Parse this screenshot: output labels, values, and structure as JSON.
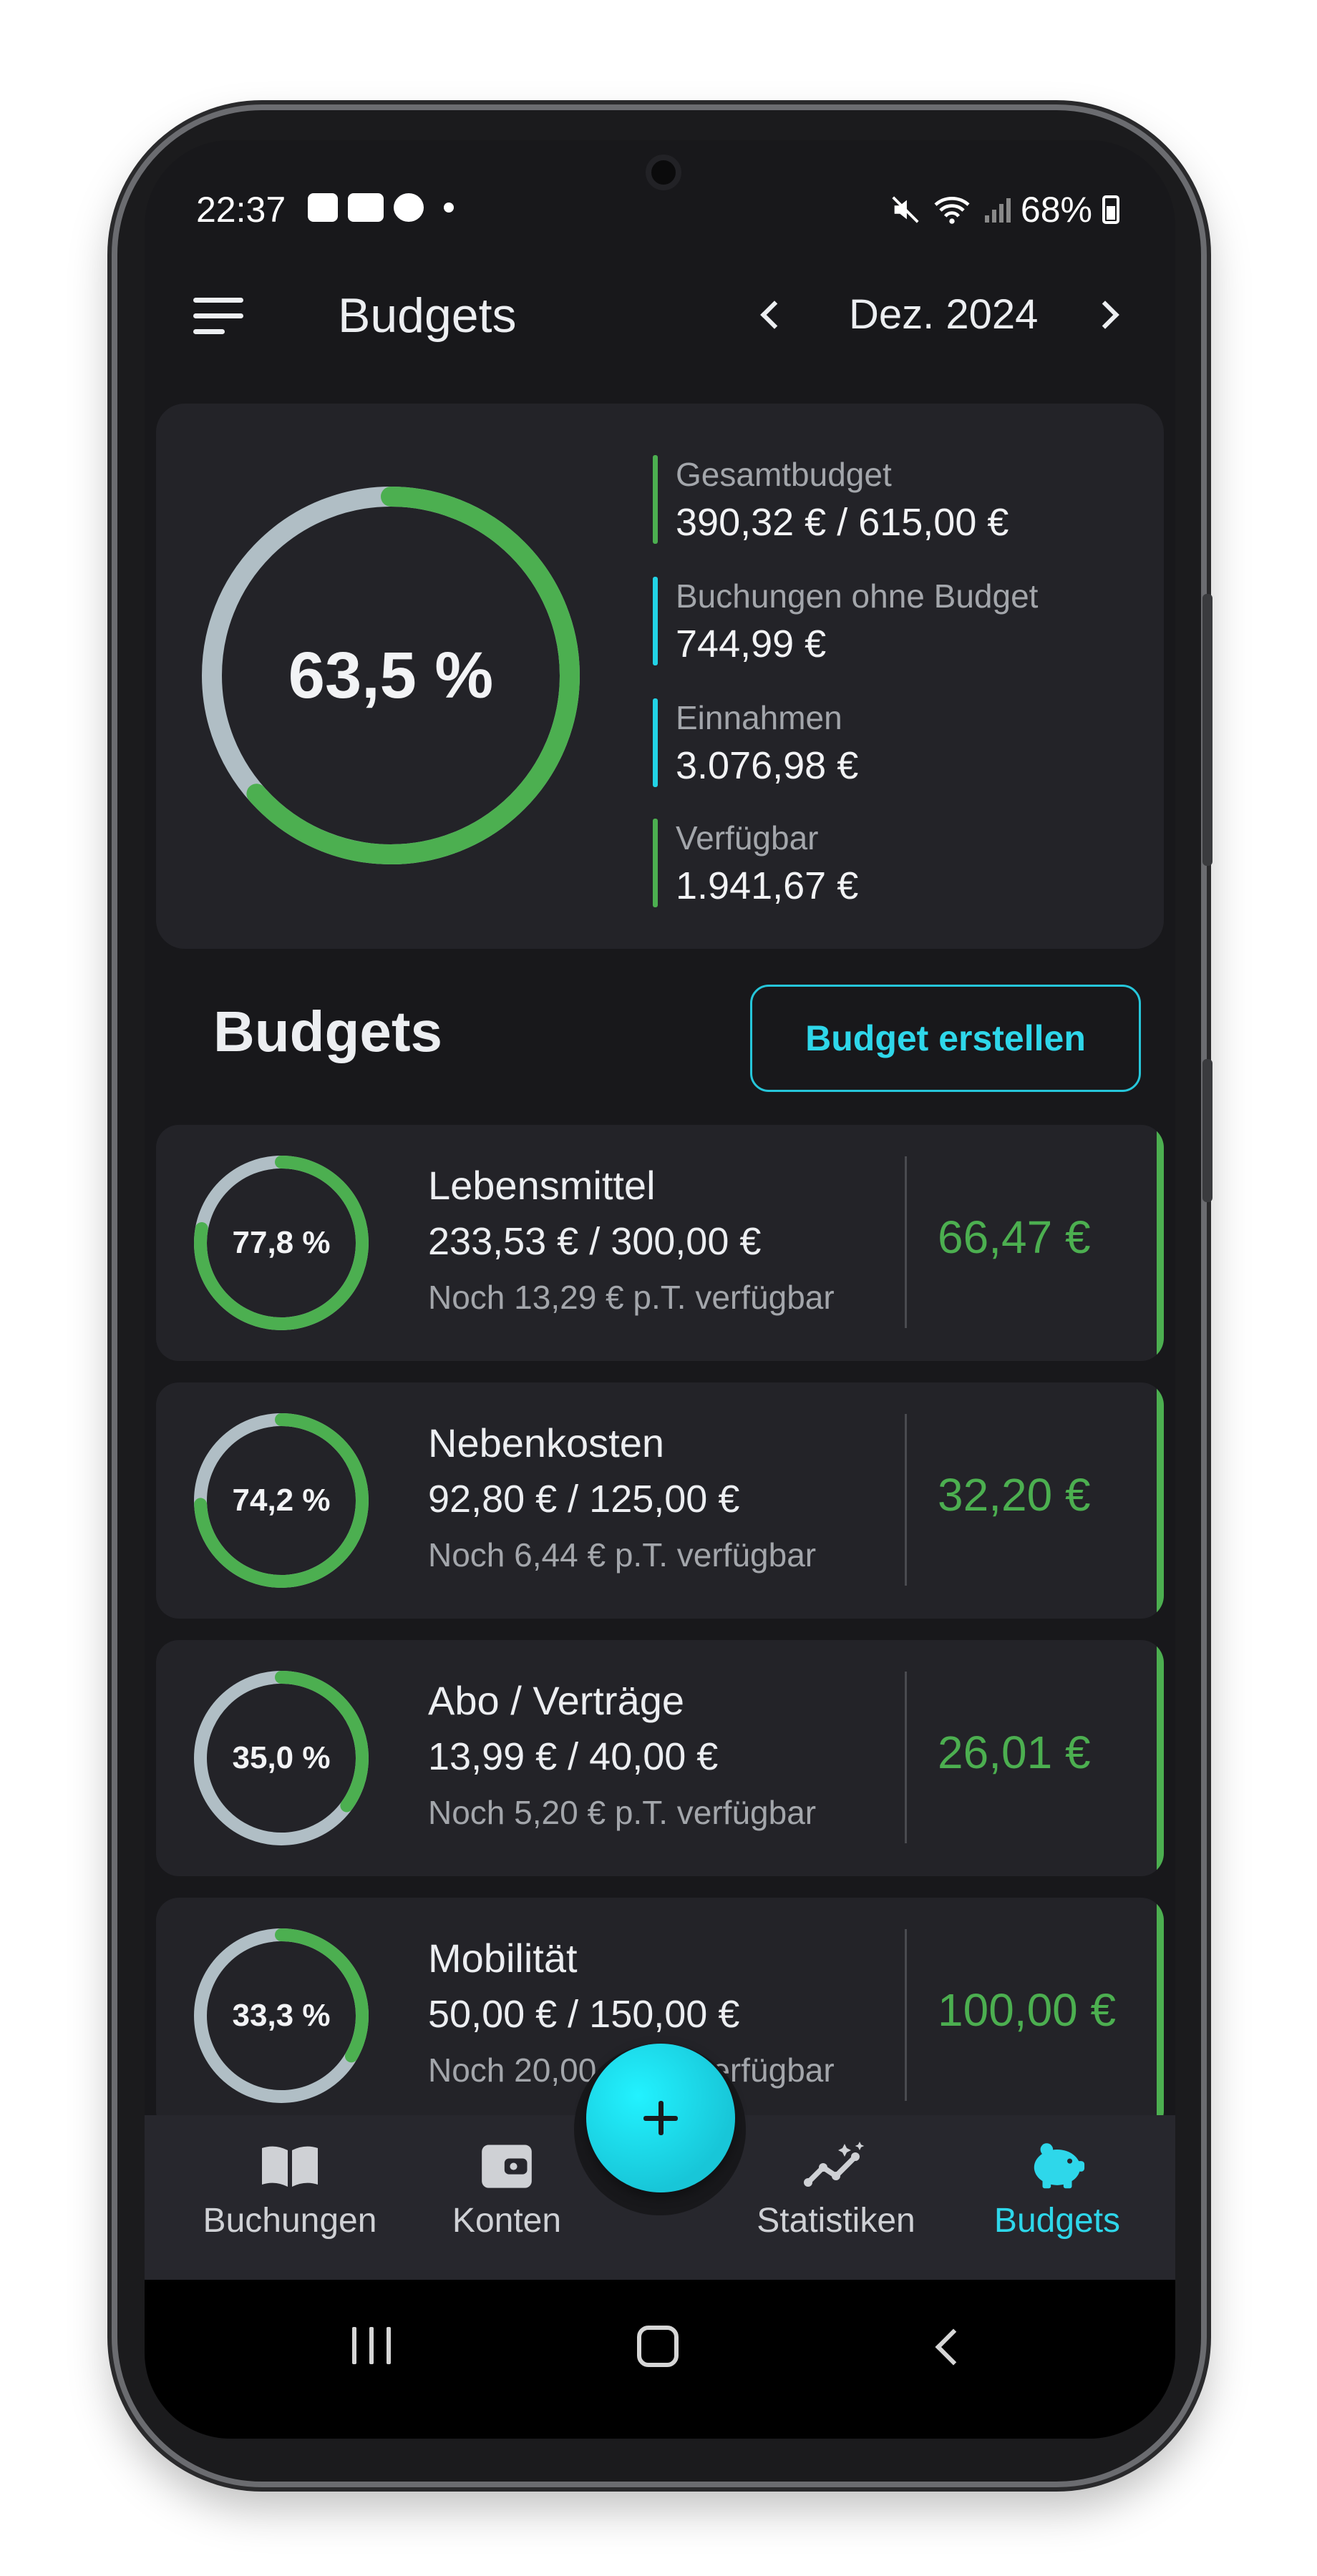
{
  "status_bar": {
    "time": "22:37",
    "battery": "68%"
  },
  "app_bar": {
    "title": "Budgets",
    "month": "Dez. 2024"
  },
  "summary": {
    "percent_label": "63,5 %",
    "percent_used": 63.5,
    "stats": [
      {
        "label": "Gesamtbudget",
        "value": "390,32 € / 615,00 €"
      },
      {
        "label": "Buchungen ohne Budget",
        "value": "744,99 €"
      },
      {
        "label": "Einnahmen",
        "value": "3.076,98 €"
      },
      {
        "label": "Verfügbar",
        "value": "1.941,67 €"
      }
    ]
  },
  "section": {
    "title": "Budgets",
    "create_button": "Budget erstellen"
  },
  "budgets": [
    {
      "percent_label": "77,8 %",
      "percent_used": 77.8,
      "name": "Lebensmittel",
      "amount": "233,53 € / 300,00 €",
      "remaining_text": "Noch 13,29 € p.T. verfügbar",
      "left": "66,47 €"
    },
    {
      "percent_label": "74,2 %",
      "percent_used": 74.2,
      "name": "Nebenkosten",
      "amount": "92,80 € / 125,00 €",
      "remaining_text": "Noch 6,44 € p.T. verfügbar",
      "left": "32,20 €"
    },
    {
      "percent_label": "35,0 %",
      "percent_used": 35.0,
      "name": "Abo / Verträge",
      "amount": "13,99 € / 40,00 €",
      "remaining_text": "Noch 5,20 € p.T. verfügbar",
      "left": "26,01 €"
    },
    {
      "percent_label": "33,3 %",
      "percent_used": 33.3,
      "name": "Mobilität",
      "amount": "50,00 € / 150,00 €",
      "remaining_text": "Noch 20,00 € p.T. verfügbar",
      "left": "100,00 €"
    }
  ],
  "bottom_nav": [
    {
      "label": "Buchungen",
      "icon": "book-icon",
      "active": false
    },
    {
      "label": "Konten",
      "icon": "wallet-icon",
      "active": false
    },
    {
      "label": "Statistiken",
      "icon": "sparkline-icon",
      "active": false
    },
    {
      "label": "Budgets",
      "icon": "piggy-bank-icon",
      "active": true
    }
  ],
  "colors": {
    "accent": "#26c6da",
    "progress": "#4caf50",
    "track": "#b0bec5",
    "card": "#232328",
    "background": "#18181b"
  }
}
